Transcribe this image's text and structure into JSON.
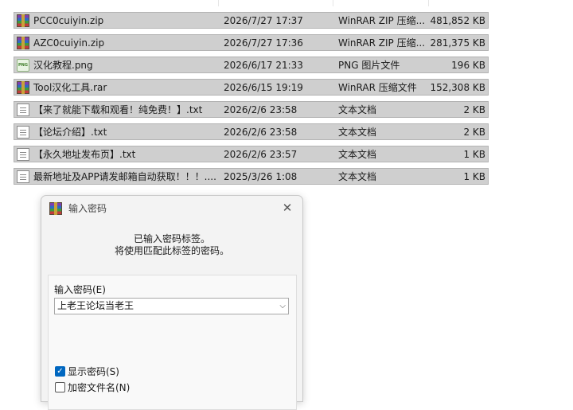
{
  "files": [
    {
      "name": "PCC0cuiyin.zip",
      "date": "2026/7/27 17:37",
      "type": "WinRAR ZIP 压缩...",
      "size": "481,852 KB",
      "icon": "zip-archive-icon"
    },
    {
      "name": "AZC0cuiyin.zip",
      "date": "2026/7/27 17:36",
      "type": "WinRAR ZIP 压缩...",
      "size": "281,375 KB",
      "icon": "zip-archive-icon"
    },
    {
      "name": "汉化教程.png",
      "date": "2026/6/17 21:33",
      "type": "PNG 图片文件",
      "size": "196 KB",
      "icon": "png-image-icon",
      "icon_text": "PNG"
    },
    {
      "name": "Tool汉化工具.rar",
      "date": "2026/6/15 19:19",
      "type": "WinRAR 压缩文件",
      "size": "152,308 KB",
      "icon": "rar-archive-icon"
    },
    {
      "name": "【来了就能下载和观看！纯免费！】.txt",
      "date": "2026/2/6 23:58",
      "type": "文本文档",
      "size": "2 KB",
      "icon": "text-file-icon"
    },
    {
      "name": "【论坛介绍】.txt",
      "date": "2026/2/6 23:58",
      "type": "文本文档",
      "size": "2 KB",
      "icon": "text-file-icon"
    },
    {
      "name": "【永久地址发布页】.txt",
      "date": "2026/2/6 23:57",
      "type": "文本文档",
      "size": "1 KB",
      "icon": "text-file-icon"
    },
    {
      "name": "最新地址及APP请发邮箱自动获取！！！....",
      "date": "2025/3/26 1:08",
      "type": "文本文档",
      "size": "1 KB",
      "icon": "text-file-icon"
    }
  ],
  "dialog": {
    "title": "输入密码",
    "close": "✕",
    "info_line1": "已输入密码标签。",
    "info_line2": "将使用匹配此标签的密码。",
    "password_label": "输入密码(E)",
    "password_value": "上老王论坛当老王",
    "dropdown_arrow": "⌵",
    "show_password": {
      "label": "显示密码(S)",
      "checked": true
    },
    "encrypt_names": {
      "label": "加密文件名(N)",
      "checked": false
    }
  }
}
